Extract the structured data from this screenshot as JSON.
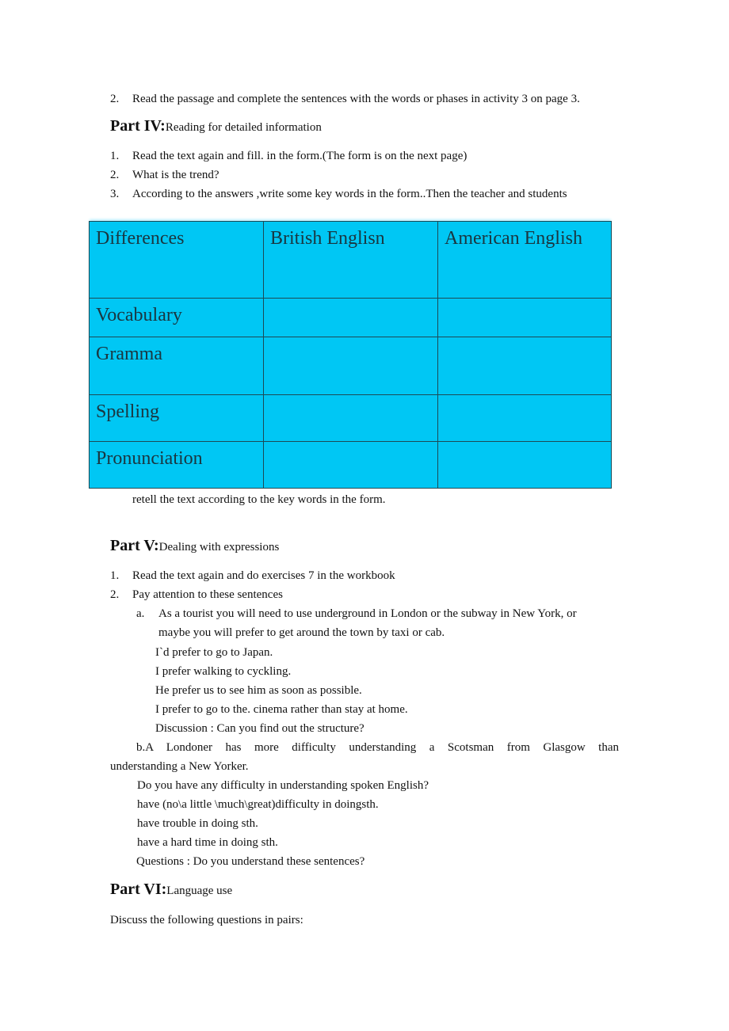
{
  "intro_item": {
    "number": "2.",
    "text": "Read the passage and complete the sentences with the words or phases in activity 3 on page 3."
  },
  "part4": {
    "label": "Part IV:",
    "title": "Reading for detailed information",
    "items": [
      {
        "number": "1.",
        "text": "Read the text again and fill.  in the form.(The form is on the next page)"
      },
      {
        "number": "2.",
        "text": "What is the trend?"
      },
      {
        "number": "3.",
        "text": "According to the answers ,write some key words in the     form..Then the teacher and students"
      }
    ],
    "continuation": "retell the text according to the key words in the form."
  },
  "form_table": {
    "headers": [
      "Differences",
      "British Englisn",
      "American English"
    ],
    "rows": [
      [
        "Vocabulary",
        "",
        ""
      ],
      [
        "Gramma",
        "",
        ""
      ],
      [
        "Spelling",
        "",
        ""
      ],
      [
        "Pronunciation",
        "",
        ""
      ]
    ],
    "background_color": "#00c7f4"
  },
  "part5": {
    "label": "Part V:",
    "title": "Dealing with expressions",
    "items": [
      {
        "number": "1.",
        "text": "Read the text again and do exercises 7 in the workbook"
      },
      {
        "number": "2.",
        "text": "Pay attention to these sentences"
      }
    ],
    "sub_a": {
      "letter": "a.",
      "line1": "As a tourist you will need to use underground in London or the subway in New York, or",
      "line2": "maybe you will prefer to get around the town    by taxi or cab.",
      "examples": [
        "I`d prefer to go to Japan.",
        "I prefer walking to cyckling.",
        "He prefer us to see him as soon as possible.",
        "I prefer to go to the.  cinema rather than stay at home.",
        "Discussion : Can you find out the structure?"
      ]
    },
    "sub_b": {
      "line1": "b.A Londoner has more difficulty understanding a Scotsman from Glasgow than",
      "line2": "understanding a New Yorker.",
      "examples": [
        "Do you have any difficulty in understanding spoken English?",
        "have (no\\a little \\much\\great)difficulty in doingsth.",
        "have trouble in doing sth.",
        "have a hard time in doing sth.",
        "Questions : Do you understand these sentences?"
      ]
    }
  },
  "part6": {
    "label": "Part VI:",
    "title": "Language use",
    "instruction": "Discuss the following questions in pairs:"
  }
}
